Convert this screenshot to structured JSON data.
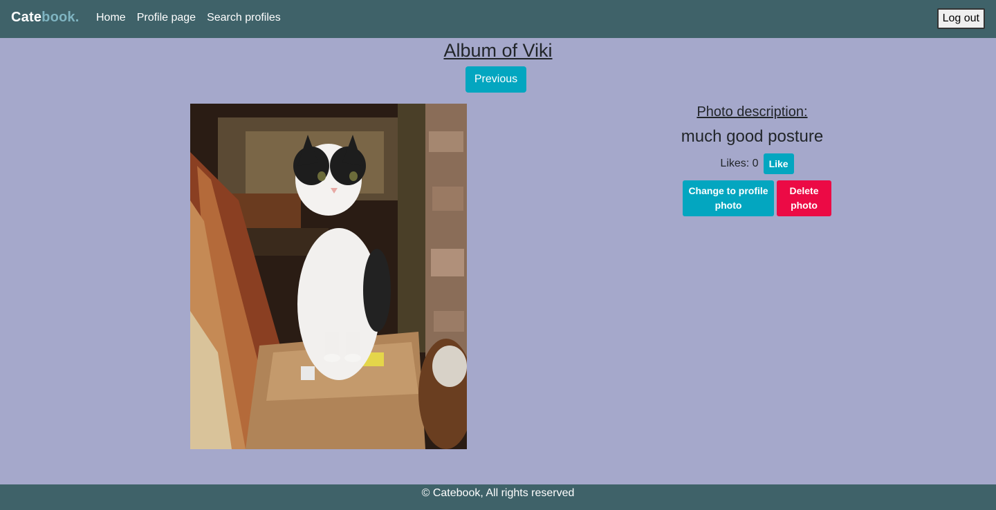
{
  "navbar": {
    "brand_part1": "Cate",
    "brand_part2": "book.",
    "links": [
      "Home",
      "Profile page",
      "Search profiles"
    ],
    "logout_label": "Log out"
  },
  "album": {
    "title": "Album of Viki",
    "previous_label": "Previous"
  },
  "photo": {
    "alt": "cat photo"
  },
  "details": {
    "description_heading": "Photo description:",
    "description_text": "much good posture",
    "likes_label": "Likes: 0",
    "like_button": "Like",
    "change_profile_button": "Change to profile photo",
    "delete_button": "Delete photo"
  },
  "footer": {
    "text": "© Catebook, All rights reserved"
  },
  "colors": {
    "navbar": "#3f6269",
    "background": "#a5a8cb",
    "accent": "#03a6c0",
    "danger": "#ec0a45"
  }
}
